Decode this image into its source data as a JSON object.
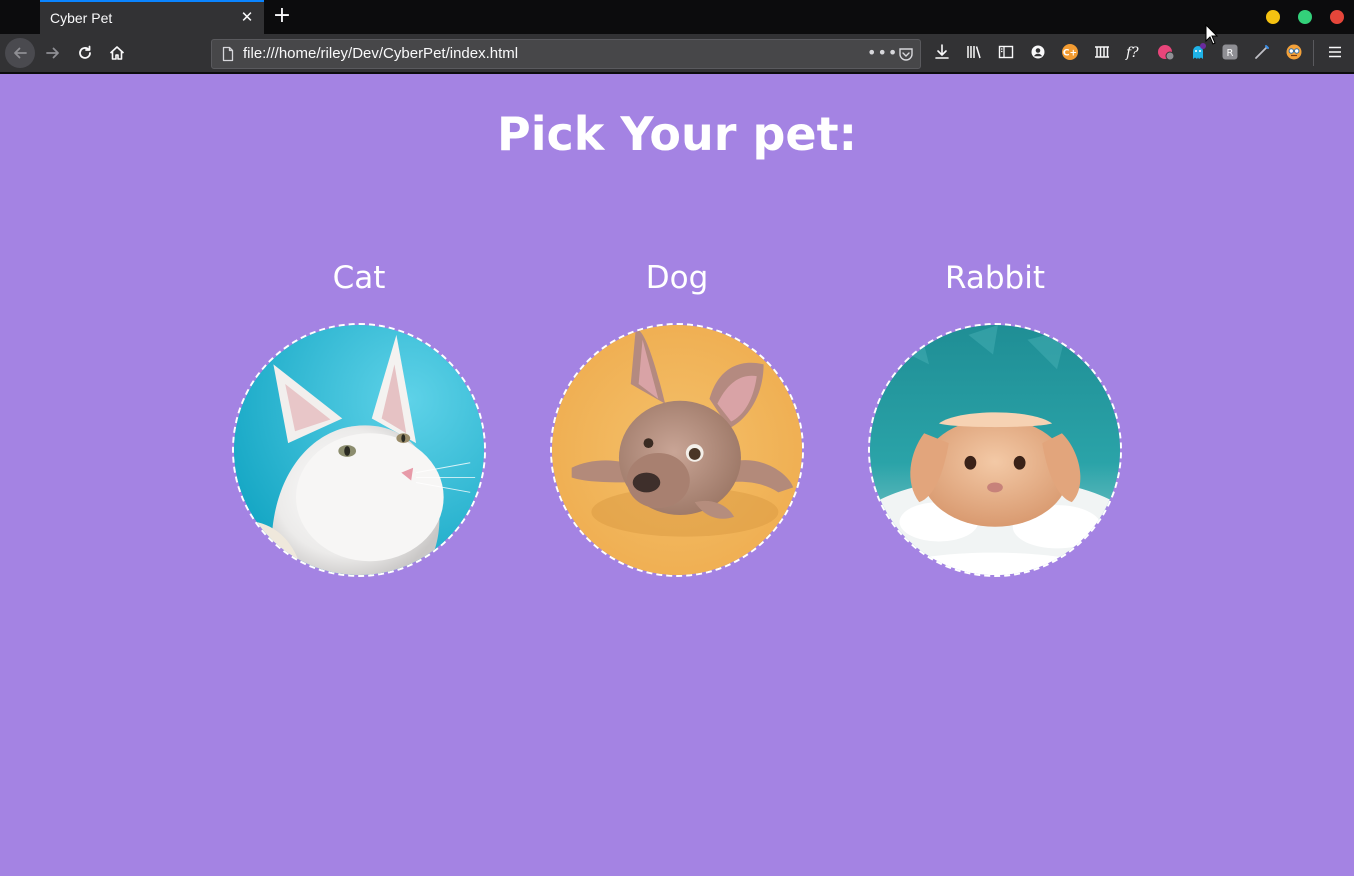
{
  "browser": {
    "tab_title": "Cyber Pet",
    "tab_close": "✕",
    "new_tab": "+",
    "url": "file:///home/riley/Dev/CyberPet/index.html",
    "url_more": "•••"
  },
  "page": {
    "heading": "Pick Your pet:",
    "background_color": "#a483e3",
    "pets": [
      {
        "name": "Cat",
        "image": "white-cat-on-blue"
      },
      {
        "name": "Dog",
        "image": "french-bulldog-on-yellow"
      },
      {
        "name": "Rabbit",
        "image": "orange-rabbit-on-teal"
      }
    ]
  }
}
